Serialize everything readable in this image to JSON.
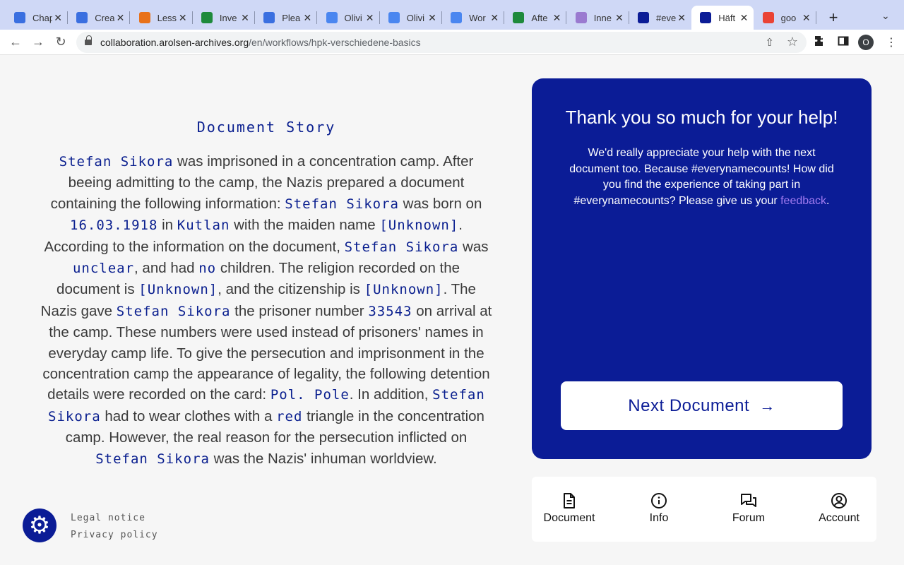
{
  "browser": {
    "tabs": [
      {
        "title": "Chap",
        "favicon_color": "#3a6fe0"
      },
      {
        "title": "Crea",
        "favicon_color": "#3a6fe0"
      },
      {
        "title": "Less",
        "favicon_color": "#e8711a"
      },
      {
        "title": "Inve",
        "favicon_color": "#1e8a3c"
      },
      {
        "title": "Plea",
        "favicon_color": "#3a6fe0"
      },
      {
        "title": "Olivi",
        "favicon_color": "#4a86f0"
      },
      {
        "title": "Olivi",
        "favicon_color": "#4a86f0"
      },
      {
        "title": "Wor",
        "favicon_color": "#4a86f0"
      },
      {
        "title": "Afte",
        "favicon_color": "#1e8a3c"
      },
      {
        "title": "Inne",
        "favicon_color": "#9a7ad0"
      },
      {
        "title": "#eve",
        "favicon_color": "#0b1c96"
      },
      {
        "title": "Häft",
        "favicon_color": "#0b1c96"
      },
      {
        "title": "goo",
        "favicon_color": "#ea4335"
      }
    ],
    "url_host": "collaboration.arolsen-archives.org",
    "url_path": "/en/workflows/hpk-verschiedene-basics",
    "profile_initial": "O"
  },
  "story": {
    "heading": "Document Story",
    "segments": [
      {
        "t": "Stefan Sikora",
        "h": true
      },
      {
        "t": " was imprisoned in a concentration camp. After beeing admitting to the camp, the Nazis prepared a document containing the following information: ",
        "h": false
      },
      {
        "t": "Stefan Sikora",
        "h": true
      },
      {
        "t": " was born on ",
        "h": false
      },
      {
        "t": "16.03.1918",
        "h": true
      },
      {
        "t": " in ",
        "h": false
      },
      {
        "t": "Kutlan",
        "h": true
      },
      {
        "t": " with the maiden name ",
        "h": false
      },
      {
        "t": "[Unknown]",
        "h": true
      },
      {
        "t": ". According to the information on the document, ",
        "h": false
      },
      {
        "t": "Stefan Sikora",
        "h": true
      },
      {
        "t": " was ",
        "h": false
      },
      {
        "t": "unclear",
        "h": true
      },
      {
        "t": ", and had ",
        "h": false
      },
      {
        "t": "no",
        "h": true
      },
      {
        "t": " children. The religion recorded on the document is ",
        "h": false
      },
      {
        "t": "[Unknown]",
        "h": true
      },
      {
        "t": ", and the citizenship is ",
        "h": false
      },
      {
        "t": "[Unknown]",
        "h": true
      },
      {
        "t": ". The Nazis gave ",
        "h": false
      },
      {
        "t": "Stefan Sikora",
        "h": true
      },
      {
        "t": " the prisoner number ",
        "h": false
      },
      {
        "t": "33543",
        "h": true
      },
      {
        "t": " on arrival at the camp. These numbers were used instead of prisoners' names in everyday camp life. To give the persecution and imprisonment in the concentration camp the appearance of legality, the following detention details were recorded on the card: ",
        "h": false
      },
      {
        "t": "Pol. Pole",
        "h": true
      },
      {
        "t": ". In addition, ",
        "h": false
      },
      {
        "t": "Stefan Sikora",
        "h": true
      },
      {
        "t": " had to wear clothes with a ",
        "h": false
      },
      {
        "t": "red",
        "h": true
      },
      {
        "t": " triangle in the concentration camp. However, the real reason for the persecution inflicted on ",
        "h": false
      },
      {
        "t": "Stefan Sikora",
        "h": true
      },
      {
        "t": " was the Nazis' inhuman worldview.",
        "h": false
      }
    ]
  },
  "footer": {
    "legal_notice": "Legal notice",
    "privacy_policy": "Privacy policy"
  },
  "thanks_panel": {
    "title": "Thank you so much for your help!",
    "message_before_link": "We'd really appreciate your help with the next document too. Because #everynamecounts! How did you find the experience of taking part in #everynamecounts? Please give us your ",
    "link_text": "feedback",
    "message_after_link": ".",
    "next_button": "Next Document"
  },
  "bottom_nav": {
    "document": "Document",
    "info": "Info",
    "forum": "Forum",
    "account": "Account"
  },
  "colors": {
    "brand_blue": "#0b1c96",
    "link_purple": "#a17bf0"
  }
}
